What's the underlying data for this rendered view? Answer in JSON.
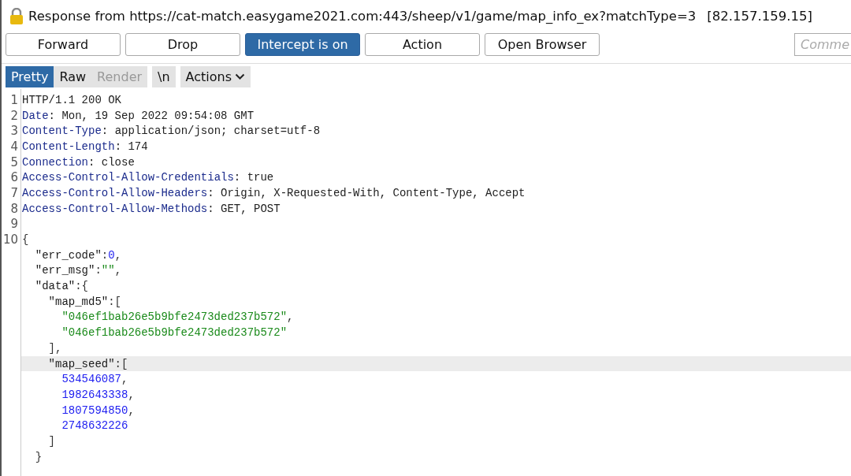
{
  "title": {
    "text": "Response from https://cat-match.easygame2021.com:443/sheep/v1/game/map_info_ex?matchType=3",
    "address": "[82.157.159.15]"
  },
  "buttons": [
    {
      "label": "Forward",
      "selected": false
    },
    {
      "label": "Drop",
      "selected": false
    },
    {
      "label": "Intercept is on",
      "selected": true
    },
    {
      "label": "Action",
      "selected": false
    },
    {
      "label": "Open Browser",
      "selected": false
    }
  ],
  "comment": {
    "placeholder": "Comme"
  },
  "view_tabs": [
    {
      "label": "Pretty",
      "selected": true,
      "disabled": false
    },
    {
      "label": "Raw",
      "selected": false,
      "disabled": false
    },
    {
      "label": "Render",
      "selected": false,
      "disabled": true
    }
  ],
  "newline_toggle": {
    "label": "\\n"
  },
  "actions_menu": {
    "label": "Actions"
  },
  "lines": [
    {
      "number": "1",
      "highlighted": false,
      "tokens": [
        {
          "kind": "plain",
          "text": "HTTP/1.1 200 OK"
        }
      ]
    },
    {
      "number": "2",
      "highlighted": false,
      "tokens": [
        {
          "kind": "header",
          "text": "Date"
        },
        {
          "kind": "plain",
          "text": ": Mon, 19 Sep 2022 09:54:08 GMT"
        }
      ]
    },
    {
      "number": "3",
      "highlighted": false,
      "tokens": [
        {
          "kind": "header",
          "text": "Content-Type"
        },
        {
          "kind": "plain",
          "text": ": application/json; charset=utf-8"
        }
      ]
    },
    {
      "number": "4",
      "highlighted": false,
      "tokens": [
        {
          "kind": "header",
          "text": "Content-Length"
        },
        {
          "kind": "plain",
          "text": ": 174"
        }
      ]
    },
    {
      "number": "5",
      "highlighted": false,
      "tokens": [
        {
          "kind": "header",
          "text": "Connection"
        },
        {
          "kind": "plain",
          "text": ": close"
        }
      ]
    },
    {
      "number": "6",
      "highlighted": false,
      "tokens": [
        {
          "kind": "header",
          "text": "Access-Control-Allow-Credentials"
        },
        {
          "kind": "plain",
          "text": ": true"
        }
      ]
    },
    {
      "number": "7",
      "highlighted": false,
      "tokens": [
        {
          "kind": "header",
          "text": "Access-Control-Allow-Headers"
        },
        {
          "kind": "plain",
          "text": ": Origin, X-Requested-With, Content-Type, Accept"
        }
      ]
    },
    {
      "number": "8",
      "highlighted": false,
      "tokens": [
        {
          "kind": "header",
          "text": "Access-Control-Allow-Methods"
        },
        {
          "kind": "plain",
          "text": ": GET, POST"
        }
      ]
    },
    {
      "number": "9",
      "highlighted": false
    },
    {
      "number": "10",
      "highlighted": false,
      "tokens": [
        {
          "kind": "punct",
          "text": "{"
        }
      ],
      "children": [
        {
          "highlighted": false,
          "tokens": [
            {
              "kind": "key",
              "text": "\"err_code\""
            },
            {
              "kind": "punct",
              "text": ":"
            },
            {
              "kind": "number",
              "text": "0"
            },
            {
              "kind": "punct",
              "text": ","
            }
          ]
        },
        {
          "highlighted": false,
          "tokens": [
            {
              "kind": "key",
              "text": "\"err_msg\""
            },
            {
              "kind": "punct",
              "text": ":"
            },
            {
              "kind": "string",
              "text": "\"\""
            },
            {
              "kind": "punct",
              "text": ","
            }
          ]
        },
        {
          "highlighted": false,
          "tokens": [
            {
              "kind": "key",
              "text": "\"data\""
            },
            {
              "kind": "punct",
              "text": ":{"
            }
          ],
          "children": [
            {
              "highlighted": false,
              "tokens": [
                {
                  "kind": "key",
                  "text": "\"map_md5\""
                },
                {
                  "kind": "punct",
                  "text": ":["
                }
              ],
              "children": [
                {
                  "highlighted": false,
                  "tokens": [
                    {
                      "kind": "string",
                      "text": "\"046ef1bab26e5b9bfe2473ded237b572\""
                    },
                    {
                      "kind": "punct",
                      "text": ","
                    }
                  ]
                },
                {
                  "highlighted": false,
                  "tokens": [
                    {
                      "kind": "string",
                      "text": "\"046ef1bab26e5b9bfe2473ded237b572\""
                    }
                  ]
                }
              ]
            },
            {
              "highlighted": false,
              "tokens": [
                {
                  "kind": "punct",
                  "text": "],"
                }
              ]
            },
            {
              "highlighted": true,
              "tokens": [
                {
                  "kind": "key",
                  "text": "\"map_seed\""
                },
                {
                  "kind": "punct",
                  "text": ":["
                }
              ],
              "children": [
                {
                  "highlighted": false,
                  "tokens": [
                    {
                      "kind": "number",
                      "text": "534546087"
                    },
                    {
                      "kind": "punct",
                      "text": ","
                    }
                  ]
                },
                {
                  "highlighted": false,
                  "tokens": [
                    {
                      "kind": "number",
                      "text": "1982643338"
                    },
                    {
                      "kind": "punct",
                      "text": ","
                    }
                  ]
                },
                {
                  "highlighted": false,
                  "tokens": [
                    {
                      "kind": "number",
                      "text": "1807594850"
                    },
                    {
                      "kind": "punct",
                      "text": ","
                    }
                  ]
                },
                {
                  "highlighted": false,
                  "tokens": [
                    {
                      "kind": "number",
                      "text": "2748632226"
                    }
                  ]
                }
              ]
            },
            {
              "highlighted": false,
              "tokens": [
                {
                  "kind": "punct",
                  "text": "]"
                }
              ]
            }
          ]
        },
        {
          "highlighted": false,
          "tokens": [
            {
              "kind": "punct",
              "text": "}"
            }
          ]
        }
      ]
    }
  ]
}
